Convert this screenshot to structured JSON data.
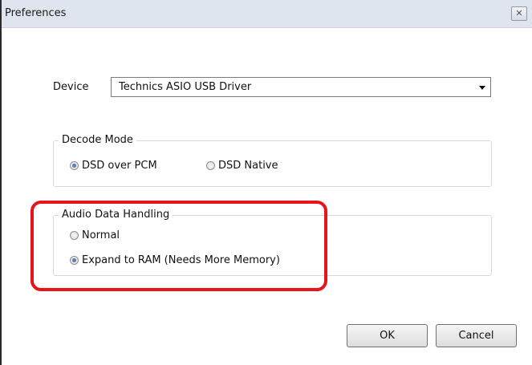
{
  "window": {
    "title": "Preferences",
    "close_glyph": "✕"
  },
  "device": {
    "label": "Device",
    "selected": "Technics ASIO USB Driver"
  },
  "decode_mode": {
    "legend": "Decode Mode",
    "options": [
      {
        "label": "DSD over PCM",
        "checked": true
      },
      {
        "label": "DSD Native",
        "checked": false
      }
    ]
  },
  "audio_data_handling": {
    "legend": "Audio Data Handling",
    "options": [
      {
        "label": "Normal",
        "checked": false
      },
      {
        "label": "Expand to RAM (Needs More Memory)",
        "checked": true
      }
    ]
  },
  "buttons": {
    "ok": "OK",
    "cancel": "Cancel"
  },
  "colors": {
    "highlight": "#e8141b",
    "titlebar": "#dfe5ef"
  }
}
